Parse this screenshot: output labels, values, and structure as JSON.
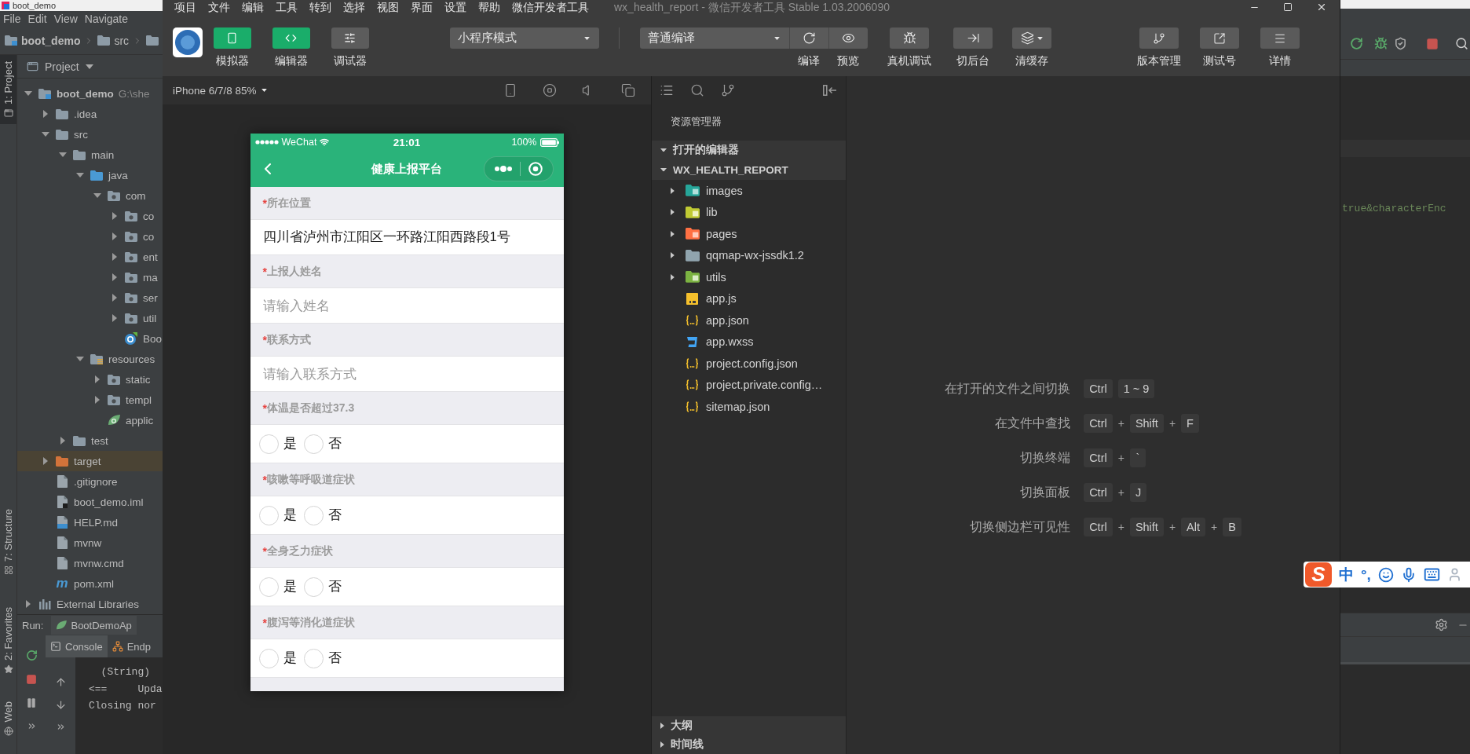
{
  "ide": {
    "title": "boot_demo",
    "menu": [
      "File",
      "Edit",
      "View",
      "Navigate"
    ],
    "breadcrumb": [
      "boot_demo",
      "src"
    ],
    "side_tabs": [
      {
        "label": "1: Project",
        "selected": true
      },
      {
        "label": "7: Structure",
        "selected": false
      },
      {
        "label": "2: Favorites",
        "selected": false
      },
      {
        "label": "Web",
        "selected": false
      }
    ],
    "project": {
      "title": "Project",
      "tree": [
        {
          "name": "boot_demo",
          "hint": "G:\\she",
          "kind": "module",
          "expanded": true,
          "selected": false,
          "children": [
            {
              "name": ".idea",
              "kind": "folder",
              "expanded": false,
              "selected": false
            },
            {
              "name": "src",
              "kind": "folder",
              "expanded": true,
              "selected": false,
              "children": [
                {
                  "name": "main",
                  "kind": "folder",
                  "expanded": true,
                  "selected": false,
                  "children": [
                    {
                      "name": "java",
                      "kind": "source",
                      "expanded": true,
                      "selected": false,
                      "children": [
                        {
                          "name": "com",
                          "kind": "package",
                          "expanded": true,
                          "selected": false,
                          "children": [
                            {
                              "name": "co",
                              "kind": "package",
                              "expanded": false,
                              "selected": false
                            },
                            {
                              "name": "co",
                              "kind": "package",
                              "expanded": false,
                              "selected": false
                            },
                            {
                              "name": "ent",
                              "kind": "package",
                              "expanded": false,
                              "selected": false
                            },
                            {
                              "name": "ma",
                              "kind": "package",
                              "expanded": false,
                              "selected": false
                            },
                            {
                              "name": "ser",
                              "kind": "package",
                              "expanded": false,
                              "selected": false
                            },
                            {
                              "name": "util",
                              "kind": "package",
                              "expanded": false,
                              "selected": false
                            },
                            {
                              "name": "Boo",
                              "kind": "boot-class",
                              "selected": false
                            }
                          ]
                        }
                      ]
                    },
                    {
                      "name": "resources",
                      "kind": "resources",
                      "expanded": true,
                      "selected": false,
                      "children": [
                        {
                          "name": "static",
                          "kind": "package",
                          "expanded": false,
                          "selected": false
                        },
                        {
                          "name": "templ",
                          "kind": "package",
                          "expanded": false,
                          "selected": false
                        },
                        {
                          "name": "applic",
                          "kind": "spring-config",
                          "selected": false
                        }
                      ]
                    }
                  ]
                },
                {
                  "name": "test",
                  "kind": "folder",
                  "expanded": false,
                  "selected": false
                }
              ]
            },
            {
              "name": "target",
              "kind": "excluded",
              "expanded": false,
              "selected": true
            },
            {
              "name": ".gitignore",
              "kind": "text",
              "selected": false
            },
            {
              "name": "boot_demo.iml",
              "kind": "iml",
              "selected": false
            },
            {
              "name": "HELP.md",
              "kind": "markdown",
              "selected": false
            },
            {
              "name": "mvnw",
              "kind": "text",
              "selected": false
            },
            {
              "name": "mvnw.cmd",
              "kind": "text",
              "selected": false
            },
            {
              "name": "pom.xml",
              "kind": "maven",
              "glyph": "m",
              "selected": false
            }
          ]
        },
        {
          "name": "External Libraries",
          "kind": "libraries",
          "expanded": false,
          "selected": false
        }
      ]
    },
    "run": {
      "label": "Run:",
      "config": "BootDemoAp",
      "tabs": [
        {
          "label": "Console",
          "selected": true
        },
        {
          "label": "Endp",
          "selected": false
        }
      ],
      "console": [
        "  (String)",
        "<==     Upda",
        "Closing nor"
      ]
    }
  },
  "devtools": {
    "menu": [
      "项目",
      "文件",
      "编辑",
      "工具",
      "转到",
      "选择",
      "视图",
      "界面",
      "设置",
      "帮助",
      "微信开发者工具"
    ],
    "title": "wx_health_report - 微信开发者工具 Stable 1.03.2006090",
    "toolbar": {
      "toggles": [
        {
          "label": "模拟器",
          "on": true
        },
        {
          "label": "编辑器",
          "on": true
        },
        {
          "label": "调试器",
          "on": false
        }
      ],
      "mode": "小程序模式",
      "compile_mode": "普通编译",
      "actions": [
        "编译",
        "预览",
        "真机调试",
        "切后台",
        "清缓存"
      ],
      "right_actions": [
        "版本管理",
        "测试号",
        "详情"
      ]
    },
    "simulator": {
      "device": "iPhone 6/7/8 85%"
    },
    "phone": {
      "carrier": "WeChat",
      "time": "21:01",
      "battery": "100%",
      "title": "健康上报平台",
      "fields": [
        {
          "kind": "text",
          "mark": "*",
          "label": "所在位置",
          "value": "四川省泸州市江阳区一环路江阳西路段1号"
        },
        {
          "kind": "text",
          "mark": "*",
          "label": "上报人姓名",
          "placeholder": "请输入姓名"
        },
        {
          "kind": "text",
          "mark": "*",
          "label": "联系方式",
          "placeholder": "请输入联系方式"
        },
        {
          "kind": "radio",
          "mark": "*",
          "label": "体温是否超过37.3",
          "options": [
            {
              "label": "是",
              "selected": false
            },
            {
              "label": "否",
              "selected": false
            }
          ]
        },
        {
          "kind": "radio",
          "mark": "*",
          "label": "咳嗽等呼吸道症状",
          "options": [
            {
              "label": "是",
              "selected": false
            },
            {
              "label": "否",
              "selected": false
            }
          ]
        },
        {
          "kind": "radio",
          "mark": "*",
          "label": "全身乏力症状",
          "options": [
            {
              "label": "是",
              "selected": false
            },
            {
              "label": "否",
              "selected": false
            }
          ]
        },
        {
          "kind": "radio",
          "mark": "*",
          "label": "腹泻等消化道症状",
          "options": [
            {
              "label": "是",
              "selected": false
            },
            {
              "label": "否",
              "selected": false
            }
          ]
        }
      ]
    },
    "explorer": {
      "title": "资源管理器",
      "sections": [
        {
          "label": "打开的编辑器",
          "expanded": true
        },
        {
          "label": "WX_HEALTH_REPORT",
          "expanded": true
        }
      ],
      "files": [
        {
          "name": "images",
          "kind": "folder-images",
          "expanded": false,
          "selected": false
        },
        {
          "name": "lib",
          "kind": "folder-lib",
          "expanded": false,
          "selected": false
        },
        {
          "name": "pages",
          "kind": "folder-pages",
          "expanded": false,
          "selected": false
        },
        {
          "name": "qqmap-wx-jssdk1.2",
          "kind": "folder",
          "expanded": false,
          "selected": false
        },
        {
          "name": "utils",
          "kind": "folder-utils",
          "expanded": false,
          "selected": false
        },
        {
          "name": "app.js",
          "kind": "js",
          "selected": false
        },
        {
          "name": "app.json",
          "kind": "json",
          "selected": false
        },
        {
          "name": "app.wxss",
          "kind": "css",
          "selected": false
        },
        {
          "name": "project.config.json",
          "kind": "json",
          "selected": false
        },
        {
          "name": "project.private.config…",
          "kind": "json",
          "selected": false
        },
        {
          "name": "sitemap.json",
          "kind": "json",
          "selected": false
        }
      ],
      "panels": [
        {
          "label": "大纲",
          "expanded": false
        },
        {
          "label": "时间线",
          "expanded": false
        }
      ]
    },
    "shortcuts": [
      {
        "label": "在打开的文件之间切换",
        "keys": [
          {
            "kind": "key",
            "text": "Ctrl"
          },
          {
            "kind": "key",
            "text": "1 ~ 9"
          }
        ]
      },
      {
        "label": "在文件中查找",
        "keys": [
          {
            "kind": "key",
            "text": "Ctrl"
          },
          {
            "kind": "plus",
            "text": "+"
          },
          {
            "kind": "key",
            "text": "Shift"
          },
          {
            "kind": "plus",
            "text": "+"
          },
          {
            "kind": "key",
            "text": "F"
          }
        ]
      },
      {
        "label": "切换终端",
        "keys": [
          {
            "kind": "key",
            "text": "Ctrl"
          },
          {
            "kind": "plus",
            "text": "+"
          },
          {
            "kind": "key",
            "text": "`"
          }
        ]
      },
      {
        "label": "切换面板",
        "keys": [
          {
            "kind": "key",
            "text": "Ctrl"
          },
          {
            "kind": "plus",
            "text": "+"
          },
          {
            "kind": "key",
            "text": "J"
          }
        ]
      },
      {
        "label": "切换侧边栏可见性",
        "keys": [
          {
            "kind": "key",
            "text": "Ctrl"
          },
          {
            "kind": "plus",
            "text": "+"
          },
          {
            "kind": "key",
            "text": "Shift"
          },
          {
            "kind": "plus",
            "text": "+"
          },
          {
            "kind": "key",
            "text": "Alt"
          },
          {
            "kind": "plus",
            "text": "+"
          },
          {
            "kind": "key",
            "text": "B"
          }
        ]
      }
    ]
  },
  "ide_right": {
    "code": "true&characterEnc",
    "ime": {
      "logo": "S",
      "mode": "中",
      "punctuation": "°,"
    }
  }
}
